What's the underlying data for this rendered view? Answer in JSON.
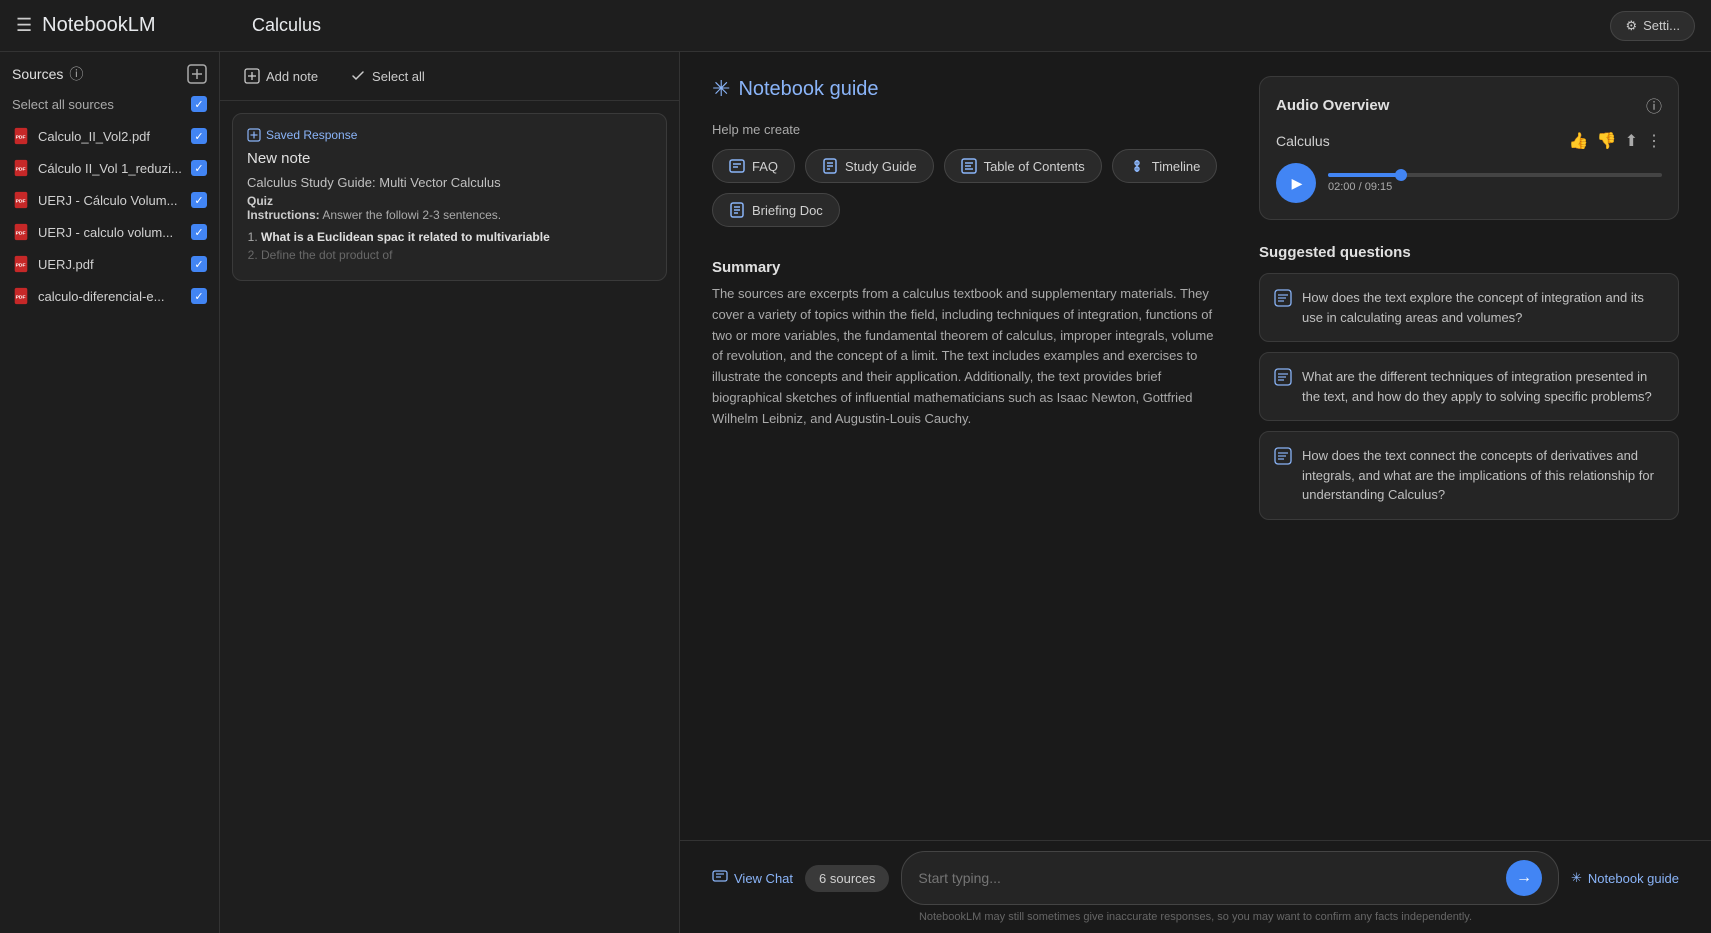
{
  "app": {
    "title": "NotebookLM",
    "notebook_name": "Calculus"
  },
  "settings_btn": "Setti...",
  "sidebar": {
    "sources_label": "Sources",
    "select_all_label": "Select all sources",
    "add_source_tooltip": "Add source",
    "sources": [
      {
        "name": "Calculo_II_Vol2.pdf",
        "checked": true
      },
      {
        "name": "Cálculo II_Vol 1_reduzi...",
        "checked": true
      },
      {
        "name": "UERJ - Cálculo Volum...",
        "checked": true
      },
      {
        "name": "UERJ - calculo volum...",
        "checked": true
      },
      {
        "name": "UERJ.pdf",
        "checked": true
      },
      {
        "name": "calculo-diferencial-e...",
        "checked": true
      }
    ]
  },
  "notes": {
    "add_note_label": "Add note",
    "select_all_label": "Select all",
    "note_card": {
      "badge": "Saved Response",
      "title": "New note",
      "subtitle": "Calculus Study Guide: Multi Vector Calculus",
      "quiz_label": "Quiz",
      "instructions_prefix": "Instructions:",
      "instructions_text": "Answer the followi 2-3 sentences.",
      "questions": [
        {
          "text": "What is a Euclidean spac it related to multivariable",
          "bold": true
        },
        {
          "text": "Define the dot product of",
          "faded": true
        }
      ]
    }
  },
  "notebook_guide": {
    "title": "Notebook guide",
    "asterisk": "✳",
    "help_create_label": "Help me create",
    "buttons": [
      {
        "id": "faq",
        "label": "FAQ",
        "icon": "list"
      },
      {
        "id": "study-guide",
        "label": "Study Guide",
        "icon": "book"
      },
      {
        "id": "table-of-contents",
        "label": "Table of Contents",
        "icon": "toc"
      },
      {
        "id": "timeline",
        "label": "Timeline",
        "icon": "timeline"
      },
      {
        "id": "briefing-doc",
        "label": "Briefing Doc",
        "icon": "doc"
      }
    ],
    "summary": {
      "title": "Summary",
      "text": "The sources are excerpts from a calculus textbook and supplementary materials. They cover a variety of topics within the field, including techniques of integration, functions of two or more variables, the fundamental theorem of calculus, improper integrals, volume of revolution, and the concept of a limit. The text includes examples and exercises to illustrate the concepts and their application. Additionally, the text provides brief biographical sketches of influential mathematicians such as Isaac Newton, Gottfried Wilhelm Leibniz, and Augustin-Louis Cauchy."
    }
  },
  "audio_overview": {
    "title": "Audio Overview",
    "track_name": "Calculus",
    "time_current": "02:00",
    "time_total": "09:15",
    "progress_percent": 22
  },
  "suggested_questions": {
    "title": "Suggested questions",
    "questions": [
      "How does the text explore the concept of integration and its use in calculating areas and volumes?",
      "What are the different techniques of integration presented in the text, and how do they apply to solving specific problems?",
      "How does the text connect the concepts of derivatives and integrals, and what are the implications of this relationship for understanding Calculus?"
    ]
  },
  "chat": {
    "view_chat_label": "View Chat",
    "sources_count": "6 sources",
    "input_placeholder": "Start typing...",
    "send_label": "→",
    "notebook_guide_label": "Notebook guide"
  },
  "disclaimer": "NotebookLM may still sometimes give inaccurate responses, so you may want to confirm any facts independently."
}
